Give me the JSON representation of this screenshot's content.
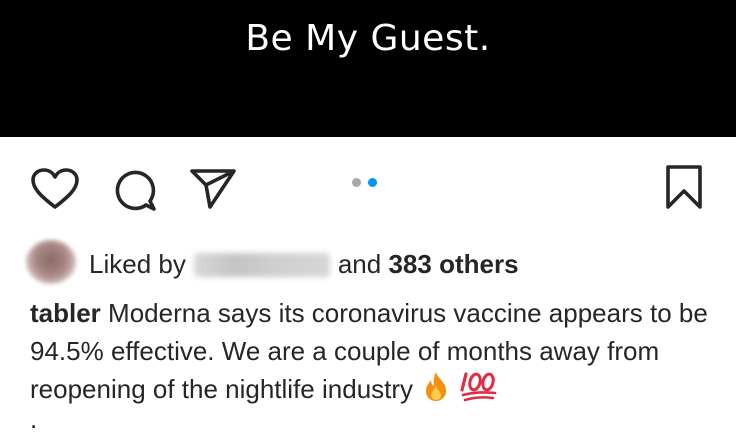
{
  "post": {
    "media_text": "Be My Guest.",
    "carousel": {
      "total": 2,
      "active": 2
    }
  },
  "likes": {
    "prefix": "Liked by",
    "joiner": "and",
    "others": "383 others"
  },
  "caption": {
    "username": "tabler",
    "text": "Moderna says its coronavirus vaccine appears to be 94.5% effective. We are a couple of months away from reopening of the nightlife industry",
    "emojis": [
      "fire-emoji",
      "hundred-points-emoji"
    ],
    "trailing": "."
  },
  "icons": {
    "like": "heart-icon",
    "comment": "comment-icon",
    "share": "paper-plane-icon",
    "save": "bookmark-icon"
  },
  "colors": {
    "media_background": "#000000",
    "active_dot": "#0095f6",
    "inactive_dot": "#a8a8a8",
    "text": "#262626"
  }
}
